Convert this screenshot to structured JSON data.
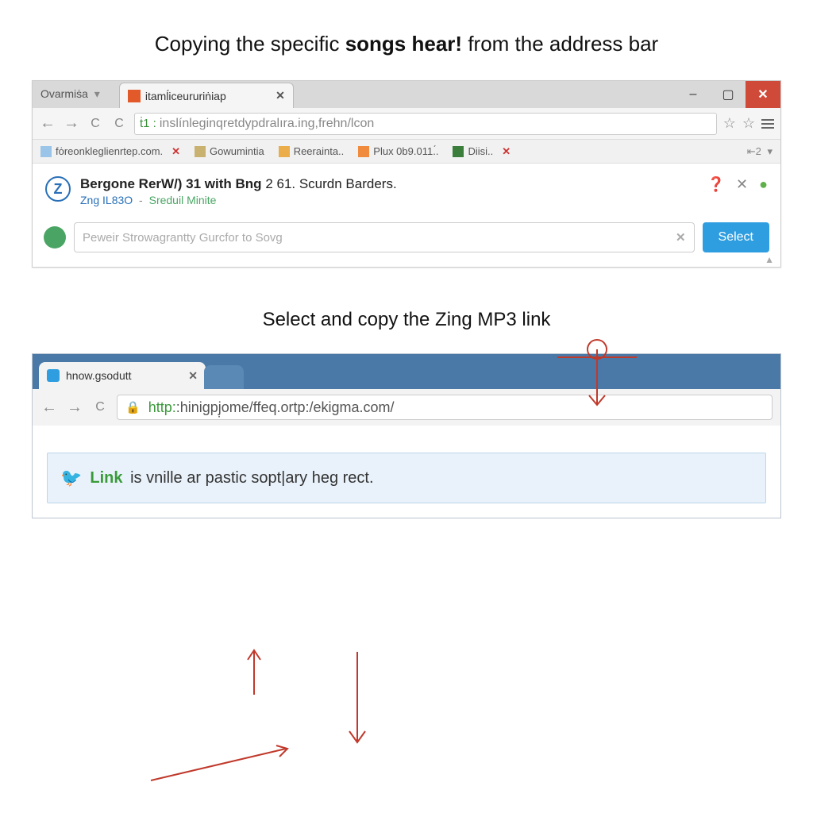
{
  "heading": {
    "pre": "Copying the specific",
    "mid": "songs hear!",
    "post": "from the address bar"
  },
  "browser1": {
    "tabs": {
      "inactive": "Ovarmiṡa",
      "active": "itamĺiceururiṅiap"
    },
    "window": {
      "min": "–",
      "max": "▢",
      "close": "✕"
    },
    "nav": {
      "back": "←",
      "fwd": "→",
      "reload": "C",
      "reload2": "C"
    },
    "address": {
      "prefix": "ṫ1 :",
      "text": "inslínleginqretdypdralıra.ing,frehn/lcon"
    },
    "stars": {
      "s1": "☆",
      "s2": "☆"
    },
    "bookmarks": [
      {
        "icon": "page",
        "label": "fȯreonkleglienrtep.com.",
        "x": "✕"
      },
      {
        "icon": "folder",
        "label": "Gowumintia"
      },
      {
        "icon": "orange",
        "label": "Reerainta.."
      },
      {
        "icon": "cal",
        "label": "Plux 0b9.011.́."
      },
      {
        "icon": "sq",
        "label": "Diisi..",
        "x": "✕"
      }
    ],
    "bm_trail": "⇤2",
    "result": {
      "badge": "Z",
      "title_b": "Bergone RerW/) 31 with Bng",
      "title_n": "2 61. Scurdn Barders.",
      "brand": "Zng IL83O",
      "muted": "Sreduil Minite",
      "icons": {
        "q": "❓",
        "x": "✕",
        "g": "●"
      }
    },
    "search": {
      "placeholder": "Peweir Strowagrantty Gurcfor to Sovg",
      "clear": "✕",
      "button": "Select"
    }
  },
  "mid_caption": "Select and copy the Zing MP3 link",
  "browser2": {
    "tab": "hnow.gsodutt",
    "tab_close": "✕",
    "nav": {
      "back": "←",
      "fwd": "→",
      "reload": "C"
    },
    "address": {
      "proto": "http:",
      "rest": ":hiniɡpj̣ome/ffeq.ortp:/ekigma.com/"
    },
    "info": {
      "link": "Link",
      "text": "is vnille ar pastic sopt|ary heg rect."
    }
  }
}
